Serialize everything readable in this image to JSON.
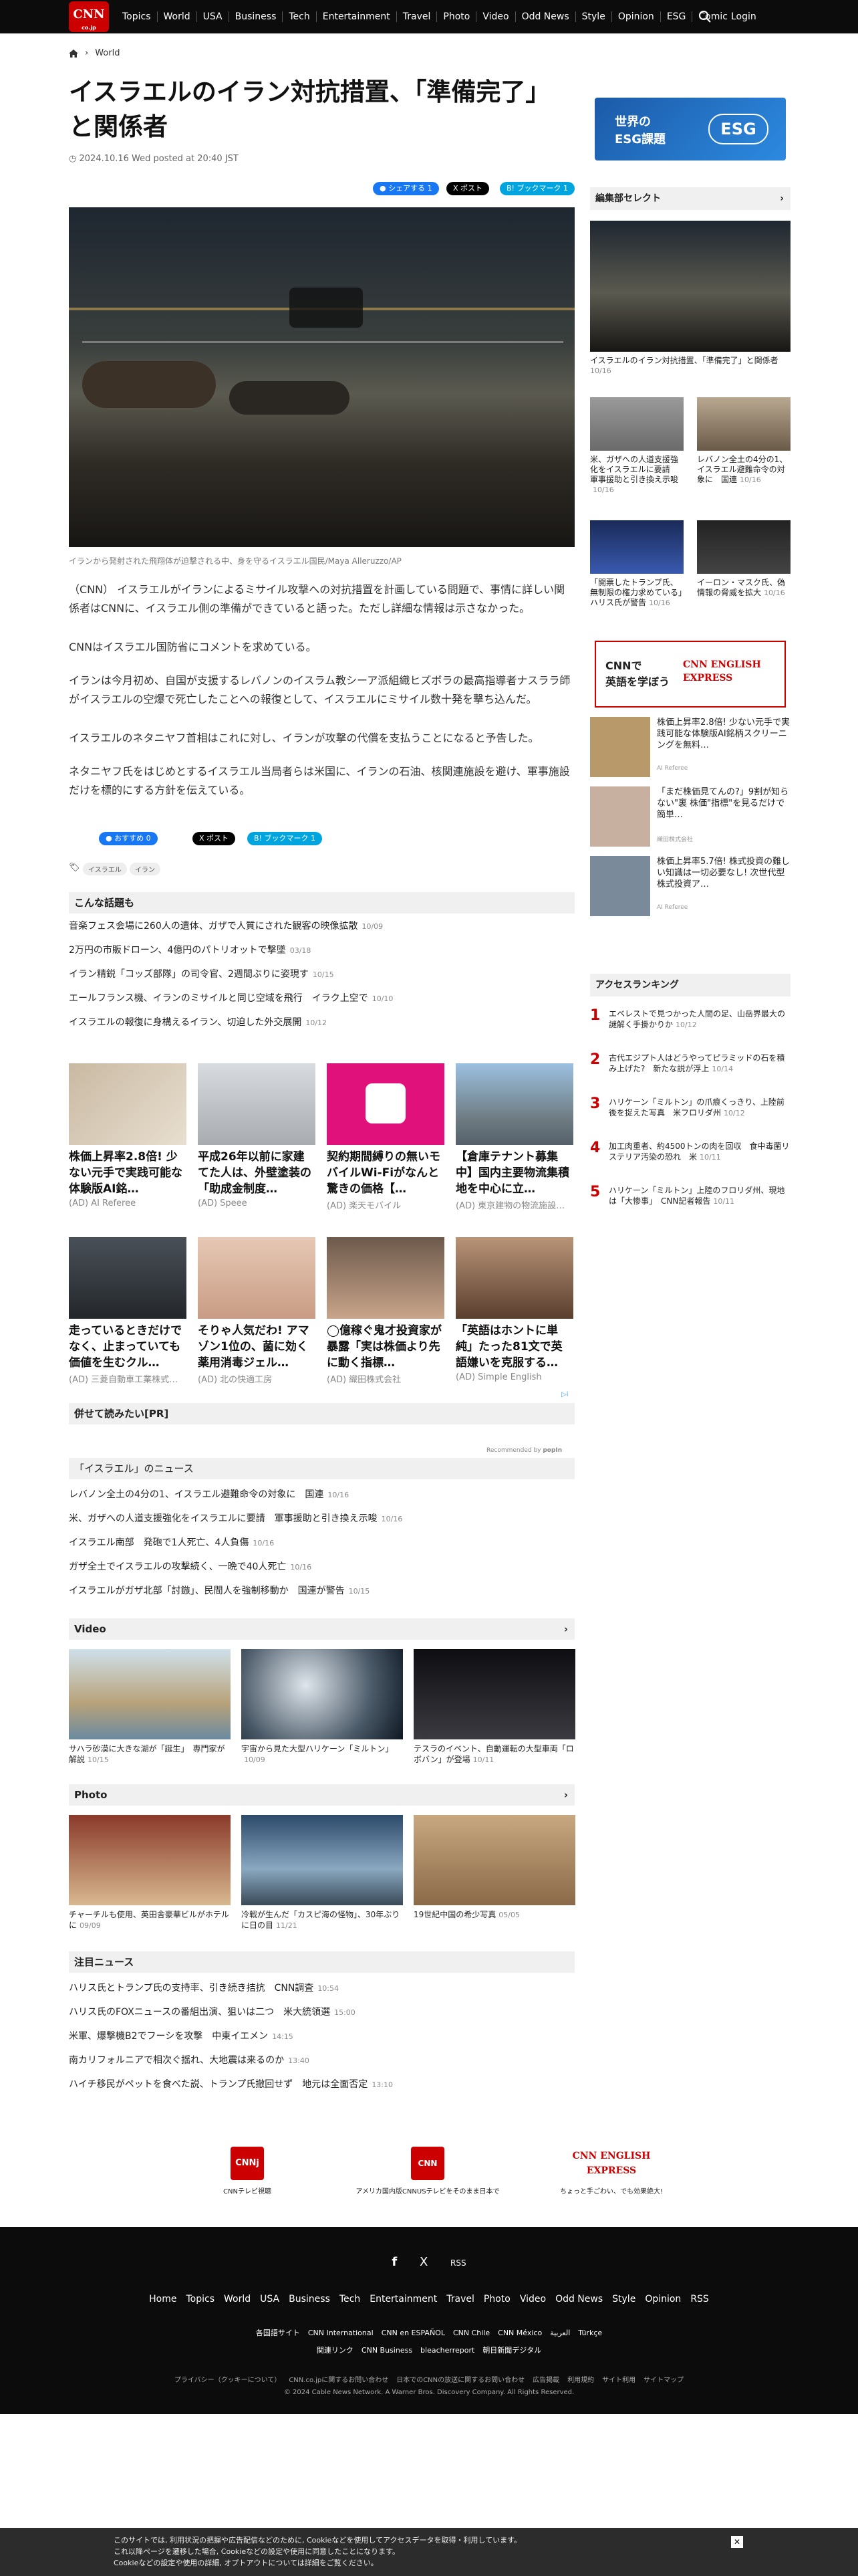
{
  "header": {
    "logo": "CNN",
    "logo_sub": "co.jp",
    "nav": [
      "Topics",
      "World",
      "USA",
      "Business",
      "Tech",
      "Entertainment",
      "Travel",
      "Photo",
      "Video",
      "Odd News",
      "Style",
      "Opinion",
      "ESG",
      "Comic"
    ],
    "login": "Login"
  },
  "breadcrumb": {
    "section": "World"
  },
  "article": {
    "title": "イスラエルのイラン対抗措置、「準備完了」と関係者",
    "date": "2024.10.16 Wed posted at 20:40 JST",
    "share_fb": "シェアする 1",
    "share_x": "ポスト",
    "share_hb": "ブックマーク 1",
    "caption": "イランから発射された飛翔体が迫撃される中、身を守るイスラエル国民/Maya Alleruzzo/AP",
    "paragraphs": [
      "（CNN） イスラエルがイランによるミサイル攻撃への対抗措置を計画している問題で、事情に詳しい関係者はCNNに、イスラエル側の準備ができていると語った。ただし詳細な情報は示さなかった。",
      "CNNはイスラエル国防省にコメントを求めている。",
      "イランは今月初め、自国が支援するレバノンのイスラム教シーア派組織ヒズボラの最高指導者ナスララ師がイスラエルの空爆で死亡したことへの報復として、イスラエルにミサイル数十発を撃ち込んだ。",
      "イスラエルのネタニヤフ首相はこれに対し、イランが攻撃の代償を支払うことになると予告した。",
      "ネタニヤフ氏をはじめとするイスラエル当局者らは米国に、イランの石油、核関連施設を避け、軍事施設だけを標的にする方針を伝えている。"
    ],
    "share2_fb": "おすすめ 0",
    "share2_x": "ポスト",
    "share2_hb": "ブックマーク 1",
    "tags": [
      "イスラエル",
      "イラン"
    ]
  },
  "related": {
    "heading": "こんな話題も",
    "items": [
      {
        "t": "音楽フェス会場に260人の遺体、ガザで人質にされた観客の映像拡散",
        "d": "10/09"
      },
      {
        "t": "2万円の市販ドローン、4億円のパトリオットで撃墜",
        "d": "03/18"
      },
      {
        "t": "イラン精鋭「コッズ部隊」の司令官、2週間ぶりに姿現す",
        "d": "10/15"
      },
      {
        "t": "エールフランス機、イランのミサイルと同じ空域を飛行　イラク上空で",
        "d": "10/10"
      },
      {
        "t": "イスラエルの報復に身構えるイラン、切迫した外交展開",
        "d": "10/12"
      }
    ]
  },
  "ads": [
    {
      "t": "株価上昇率2.8倍! 少ない元手で実践可能な体験版AI銘…",
      "s": "(AD) AI Referee"
    },
    {
      "t": "平成26年以前に家建てた人は、外壁塗装の「助成金制度…",
      "s": "(AD) Speee"
    },
    {
      "t": "契約期間縛りの無いモバイルWi-Fiがなんと驚きの価格【…",
      "s": "(AD) 楽天モバイル"
    },
    {
      "t": "【倉庫テナント募集中】国内主要物流集積地を中心に立…",
      "s": "(AD) 東京建物の物流施設…"
    },
    {
      "t": "走っているときだけでなく、止まっていても価値を生むクル…",
      "s": "(AD) 三菱自動車工業株式…"
    },
    {
      "t": "そりゃ人気だわ! アマゾン1位の、菌に効く薬用消毒ジェル…",
      "s": "(AD) 北の快適工房"
    },
    {
      "t": "◯億稼ぐ鬼才投資家が暴露「実は株価より先に動く指標…",
      "s": "(AD) 織田株式会社"
    },
    {
      "t": "「英語はホントに単純」たった81文で英語嫌いを克服する…",
      "s": "(AD) Simple English"
    }
  ],
  "pr": {
    "heading": "併せて読みたい[PR]",
    "recommended": "Recommended by",
    "brand": "popIn"
  },
  "israel": {
    "heading": "「イスラエル」のニュース",
    "items": [
      {
        "t": "レバノン全土の4分の1、イスラエル避難命令の対象に　国連",
        "d": "10/16"
      },
      {
        "t": "米、ガザへの人道支援強化をイスラエルに要請　軍事援助と引き換え示唆",
        "d": "10/16"
      },
      {
        "t": "イスラエル南部　発砲で1人死亡、4人負傷",
        "d": "10/16"
      },
      {
        "t": "ガザ全土でイスラエルの攻撃続く、一晩で40人死亡",
        "d": "10/16"
      },
      {
        "t": "イスラエルがガザ北部「討鏃」、民間人を強制移動か　国連が警告",
        "d": "10/15"
      }
    ]
  },
  "video": {
    "heading": "Video",
    "items": [
      {
        "t": "サハラ砂漠に大きな湖が「誕生」　専門家が解説",
        "d": "10/15"
      },
      {
        "t": "宇宙から見た大型ハリケーン「ミルトン」",
        "d": "10/09"
      },
      {
        "t": "テスラのイベント、自動運転の大型車両「ロボバン」が登場",
        "d": "10/11"
      }
    ]
  },
  "photo": {
    "heading": "Photo",
    "items": [
      {
        "t": "チャーチルも使用、英田舎豪華ビルがホテルに",
        "d": "09/09"
      },
      {
        "t": "冷戦が生んだ「カスピ海の怪物」、30年ぶりに日の目",
        "d": "11/21"
      },
      {
        "t": "19世紀中国の希少写真",
        "d": "05/05"
      }
    ]
  },
  "featured": {
    "heading": "注目ニュース",
    "items": [
      {
        "t": "ハリス氏とトランプ氏の支持率、引き続き拮抗　CNN調査",
        "d": "10:54"
      },
      {
        "t": "ハリス氏のFOXニュースの番組出演、狙いは二つ　米大統領選",
        "d": "15:00"
      },
      {
        "t": "米軍、爆撃機B2でフーシを攻撃　中東イエメン",
        "d": "14:15"
      },
      {
        "t": "南カリフォルニアで相次ぐ揺れ、大地震は来るのか",
        "d": "13:40"
      },
      {
        "t": "ハイチ移民がペットを食べた説、トランプ氏撤回せず　地元は全面否定",
        "d": "13:10"
      }
    ]
  },
  "promos": [
    {
      "logo": "CNNj",
      "t": "CNNテレビ視聴"
    },
    {
      "logo": "CNN US",
      "t": "アメリカ国内版CNNUSテレビをそのまま日本で"
    },
    {
      "logo": "CNN ENGLISH EXPRESS",
      "t": "ちょっと手ごわい、でも効果絶大!"
    }
  ],
  "sidebar": {
    "esg_line1": "世界の",
    "esg_line2": "ESG課題",
    "esg_tag": "ESG",
    "editor_heading": "編集部セレクト",
    "editor_main": {
      "t": "イスラエルのイラン対抗措置、「準備完了」と関係者",
      "d": "10/16"
    },
    "editor_items": [
      {
        "t": "米、ガザへの人道支援強化をイスラエルに要請　軍事援助と引き換え示唆",
        "d": "10/16"
      },
      {
        "t": "レバノン全土の4分の1、イスラエル避難命令の対象に　国連",
        "d": "10/16"
      },
      {
        "t": "「開票したトランプ氏、無制限の権力求めている」ハリス氏が警告",
        "d": "10/16"
      },
      {
        "t": "イーロン・マスク氏、偽情報の脅威を拡大",
        "d": "10/16"
      }
    ],
    "ee_line1": "CNNで",
    "ee_line2": "英語を学ぼう",
    "ee_logo": "CNN ENGLISH EXPRESS",
    "side_ads": [
      {
        "t": "株価上昇率2.8倍! 少ない元手で実践可能な体験版AI銘柄スクリーニングを無料…",
        "s": "AI Referee"
      },
      {
        "t": "「まだ株価見てんの?」9割が知らない\"裏 株価\"指標\"を見るだけで簡単…",
        "s": "織田株式会社"
      },
      {
        "t": "株価上昇率5.7倍! 株式投資の難しい知識は一切必要なし! 次世代型株式投資ア…",
        "s": "AI Referee"
      }
    ],
    "ranking_heading": "アクセスランキング",
    "ranking": [
      {
        "n": "1",
        "t": "エベレストで見つかった人間の足、山岳界最大の謎解く手掛かりか",
        "d": "10/12"
      },
      {
        "n": "2",
        "t": "古代エジプト人はどうやってピラミッドの石を積み上げた?　新たな説が浮上",
        "d": "10/14"
      },
      {
        "n": "3",
        "t": "ハリケーン「ミルトン」の爪痕くっきり、上陸前後を捉えた写真　米フロリダ州",
        "d": "10/12"
      },
      {
        "n": "4",
        "t": "加工肉重者、約4500トンの肉を回収　食中毒菌リステリア汚染の恐れ　米",
        "d": "10/11"
      },
      {
        "n": "5",
        "t": "ハリケーン「ミルトン」上陸のフロリダ州、現地は「大惨事」　CNN記者報告",
        "d": "10/11"
      }
    ]
  },
  "footer": {
    "social": [
      "f",
      "X",
      "RSS"
    ],
    "nav": [
      "Home",
      "Topics",
      "World",
      "USA",
      "Business",
      "Tech",
      "Entertainment",
      "Travel",
      "Photo",
      "Video",
      "Odd News",
      "Style",
      "Opinion",
      "RSS"
    ],
    "sites_label": "各国語サイト",
    "sites": [
      "CNN International",
      "CNN en ESPAÑOL",
      "CNN Chile",
      "CNN México",
      "العربية",
      "Türkçe"
    ],
    "related_label": "関連リンク",
    "related": [
      "CNN Business",
      "bleacherreport",
      "朝日新聞デジタル"
    ],
    "small": [
      "プライバシー（クッキーについて）",
      "CNN.co.jpに関するお問い合わせ",
      "日本でのCNNの放送に関するお問い合わせ",
      "広告掲載",
      "利用規約",
      "サイト利用",
      "サイトマップ"
    ],
    "copyright": "© 2024 Cable News Network. A Warner Bros. Discovery Company. All Rights Reserved."
  },
  "cookie": {
    "line1": "このサイトでは, 利用状況の把握や広告配信などのために, Cookieなどを使用してアクセスデータを取得・利用しています。",
    "line2": "これ以降ページを遷移した場合, Cookieなどの設定や使用に同意したことになります。",
    "line3": "Cookieなどの設定や使用の詳細, オプトアウトについては詳細をご覧ください。",
    "close": "✕"
  },
  "colors": {
    "brand": "#cc0000",
    "bg_dark": "#0c0c0c"
  }
}
